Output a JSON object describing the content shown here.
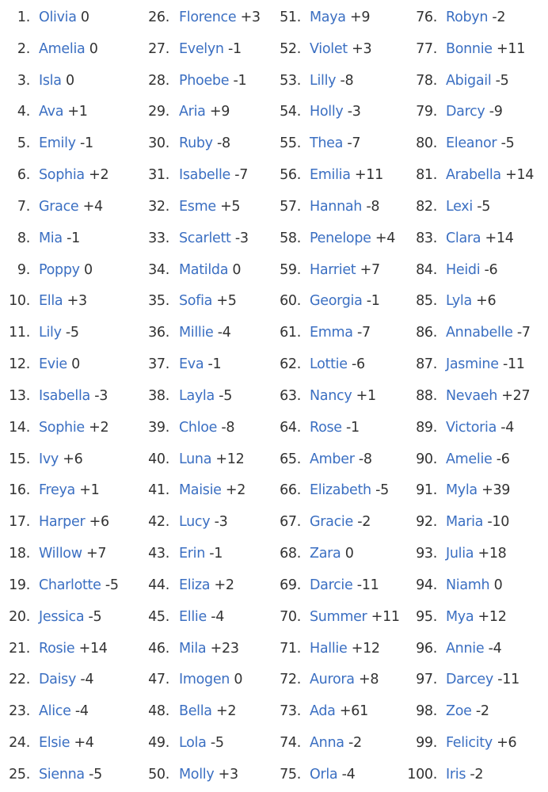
{
  "accent_color": "#3b6fc2",
  "text_color": "#333333",
  "items": [
    {
      "rank": "1.",
      "name": "Olivia",
      "change": "0"
    },
    {
      "rank": "2.",
      "name": "Amelia",
      "change": "0"
    },
    {
      "rank": "3.",
      "name": "Isla",
      "change": "0"
    },
    {
      "rank": "4.",
      "name": "Ava",
      "change": "+1"
    },
    {
      "rank": "5.",
      "name": "Emily",
      "change": "-1"
    },
    {
      "rank": "6.",
      "name": "Sophia",
      "change": "+2"
    },
    {
      "rank": "7.",
      "name": "Grace",
      "change": "+4"
    },
    {
      "rank": "8.",
      "name": "Mia",
      "change": "-1"
    },
    {
      "rank": "9.",
      "name": "Poppy",
      "change": "0"
    },
    {
      "rank": "10.",
      "name": "Ella",
      "change": "+3"
    },
    {
      "rank": "11.",
      "name": "Lily",
      "change": "-5"
    },
    {
      "rank": "12.",
      "name": "Evie",
      "change": "0"
    },
    {
      "rank": "13.",
      "name": "Isabella",
      "change": "-3"
    },
    {
      "rank": "14.",
      "name": "Sophie",
      "change": "+2"
    },
    {
      "rank": "15.",
      "name": "Ivy",
      "change": "+6"
    },
    {
      "rank": "16.",
      "name": "Freya",
      "change": "+1"
    },
    {
      "rank": "17.",
      "name": "Harper",
      "change": "+6"
    },
    {
      "rank": "18.",
      "name": "Willow",
      "change": "+7"
    },
    {
      "rank": "19.",
      "name": "Charlotte",
      "change": "-5"
    },
    {
      "rank": "20.",
      "name": "Jessica",
      "change": "-5"
    },
    {
      "rank": "21.",
      "name": "Rosie",
      "change": "+14"
    },
    {
      "rank": "22.",
      "name": "Daisy",
      "change": "-4"
    },
    {
      "rank": "23.",
      "name": "Alice",
      "change": "-4"
    },
    {
      "rank": "24.",
      "name": "Elsie",
      "change": "+4"
    },
    {
      "rank": "25.",
      "name": "Sienna",
      "change": "-5"
    },
    {
      "rank": "26.",
      "name": "Florence",
      "change": "+3"
    },
    {
      "rank": "27.",
      "name": "Evelyn",
      "change": "-1"
    },
    {
      "rank": "28.",
      "name": "Phoebe",
      "change": "-1"
    },
    {
      "rank": "29.",
      "name": "Aria",
      "change": "+9"
    },
    {
      "rank": "30.",
      "name": "Ruby",
      "change": "-8"
    },
    {
      "rank": "31.",
      "name": "Isabelle",
      "change": "-7"
    },
    {
      "rank": "32.",
      "name": "Esme",
      "change": "+5"
    },
    {
      "rank": "33.",
      "name": "Scarlett",
      "change": "-3"
    },
    {
      "rank": "34.",
      "name": "Matilda",
      "change": "0"
    },
    {
      "rank": "35.",
      "name": "Sofia",
      "change": "+5"
    },
    {
      "rank": "36.",
      "name": "Millie",
      "change": "-4"
    },
    {
      "rank": "37.",
      "name": "Eva",
      "change": "-1"
    },
    {
      "rank": "38.",
      "name": "Layla",
      "change": "-5"
    },
    {
      "rank": "39.",
      "name": "Chloe",
      "change": "-8"
    },
    {
      "rank": "40.",
      "name": "Luna",
      "change": "+12"
    },
    {
      "rank": "41.",
      "name": "Maisie",
      "change": "+2"
    },
    {
      "rank": "42.",
      "name": "Lucy",
      "change": "-3"
    },
    {
      "rank": "43.",
      "name": "Erin",
      "change": "-1"
    },
    {
      "rank": "44.",
      "name": "Eliza",
      "change": "+2"
    },
    {
      "rank": "45.",
      "name": "Ellie",
      "change": "-4"
    },
    {
      "rank": "46.",
      "name": "Mila",
      "change": "+23"
    },
    {
      "rank": "47.",
      "name": "Imogen",
      "change": "0"
    },
    {
      "rank": "48.",
      "name": "Bella",
      "change": "+2"
    },
    {
      "rank": "49.",
      "name": "Lola",
      "change": "-5"
    },
    {
      "rank": "50.",
      "name": "Molly",
      "change": "+3"
    },
    {
      "rank": "51.",
      "name": "Maya",
      "change": "+9"
    },
    {
      "rank": "52.",
      "name": "Violet",
      "change": "+3"
    },
    {
      "rank": "53.",
      "name": "Lilly",
      "change": "-8"
    },
    {
      "rank": "54.",
      "name": "Holly",
      "change": "-3"
    },
    {
      "rank": "55.",
      "name": "Thea",
      "change": "-7"
    },
    {
      "rank": "56.",
      "name": "Emilia",
      "change": "+11"
    },
    {
      "rank": "57.",
      "name": "Hannah",
      "change": "-8"
    },
    {
      "rank": "58.",
      "name": "Penelope",
      "change": "+4"
    },
    {
      "rank": "59.",
      "name": "Harriet",
      "change": "+7"
    },
    {
      "rank": "60.",
      "name": "Georgia",
      "change": "-1"
    },
    {
      "rank": "61.",
      "name": "Emma",
      "change": "-7"
    },
    {
      "rank": "62.",
      "name": "Lottie",
      "change": "-6"
    },
    {
      "rank": "63.",
      "name": "Nancy",
      "change": "+1"
    },
    {
      "rank": "64.",
      "name": "Rose",
      "change": "-1"
    },
    {
      "rank": "65.",
      "name": "Amber",
      "change": "-8"
    },
    {
      "rank": "66.",
      "name": "Elizabeth",
      "change": "-5"
    },
    {
      "rank": "67.",
      "name": "Gracie",
      "change": "-2"
    },
    {
      "rank": "68.",
      "name": "Zara",
      "change": "0"
    },
    {
      "rank": "69.",
      "name": "Darcie",
      "change": "-11"
    },
    {
      "rank": "70.",
      "name": "Summer",
      "change": "+11"
    },
    {
      "rank": "71.",
      "name": "Hallie",
      "change": "+12"
    },
    {
      "rank": "72.",
      "name": "Aurora",
      "change": "+8"
    },
    {
      "rank": "73.",
      "name": "Ada",
      "change": "+61"
    },
    {
      "rank": "74.",
      "name": "Anna",
      "change": "-2"
    },
    {
      "rank": "75.",
      "name": "Orla",
      "change": "-4"
    },
    {
      "rank": "76.",
      "name": "Robyn",
      "change": "-2"
    },
    {
      "rank": "77.",
      "name": "Bonnie",
      "change": "+11"
    },
    {
      "rank": "78.",
      "name": "Abigail",
      "change": "-5"
    },
    {
      "rank": "79.",
      "name": "Darcy",
      "change": "-9"
    },
    {
      "rank": "80.",
      "name": "Eleanor",
      "change": "-5"
    },
    {
      "rank": "81.",
      "name": "Arabella",
      "change": "+14"
    },
    {
      "rank": "82.",
      "name": "Lexi",
      "change": "-5"
    },
    {
      "rank": "83.",
      "name": "Clara",
      "change": "+14"
    },
    {
      "rank": "84.",
      "name": "Heidi",
      "change": "-6"
    },
    {
      "rank": "85.",
      "name": "Lyla",
      "change": "+6"
    },
    {
      "rank": "86.",
      "name": "Annabelle",
      "change": "-7"
    },
    {
      "rank": "87.",
      "name": "Jasmine",
      "change": "-11"
    },
    {
      "rank": "88.",
      "name": "Nevaeh",
      "change": "+27"
    },
    {
      "rank": "89.",
      "name": "Victoria",
      "change": "-4"
    },
    {
      "rank": "90.",
      "name": "Amelie",
      "change": "-6"
    },
    {
      "rank": "91.",
      "name": "Myla",
      "change": "+39"
    },
    {
      "rank": "92.",
      "name": "Maria",
      "change": "-10"
    },
    {
      "rank": "93.",
      "name": "Julia",
      "change": "+18"
    },
    {
      "rank": "94.",
      "name": "Niamh",
      "change": "0"
    },
    {
      "rank": "95.",
      "name": "Mya",
      "change": "+12"
    },
    {
      "rank": "96.",
      "name": "Annie",
      "change": "-4"
    },
    {
      "rank": "97.",
      "name": "Darcey",
      "change": "-11"
    },
    {
      "rank": "98.",
      "name": "Zoe",
      "change": "-2"
    },
    {
      "rank": "99.",
      "name": "Felicity",
      "change": "+6"
    },
    {
      "rank": "100.",
      "name": "Iris",
      "change": "-2"
    }
  ]
}
